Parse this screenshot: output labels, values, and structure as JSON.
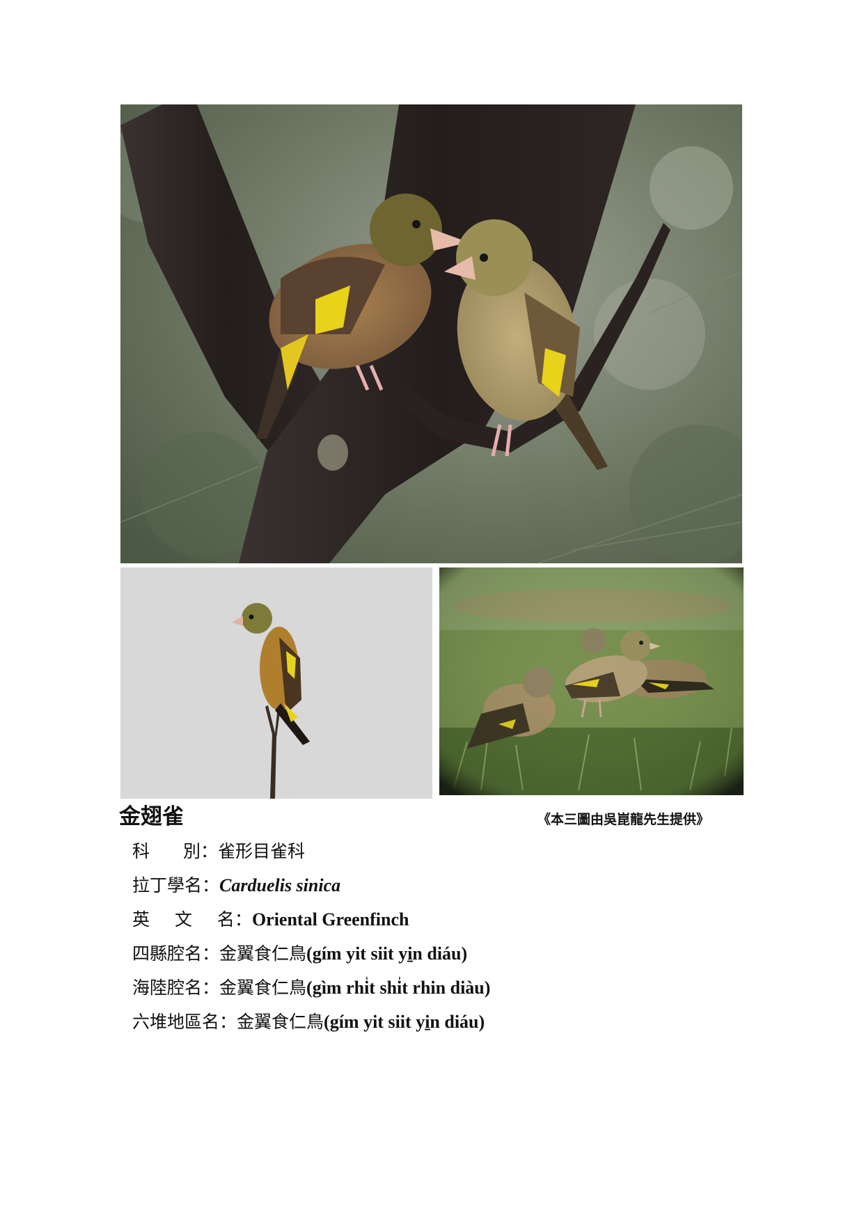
{
  "species": {
    "name": "金翅雀",
    "credit": "《本三圖由吳崑龍先生提供》"
  },
  "info": {
    "family": {
      "label_a": "科",
      "label_b": "別",
      "colon": "：",
      "value": "雀形目雀科"
    },
    "latin": {
      "label": "拉丁學名",
      "colon": "：",
      "value": "Carduelis sinica"
    },
    "english": {
      "label_a": "英 文 ",
      "label_b": "名",
      "colon": "：",
      "value": "Oriental Greenfinch"
    },
    "sixian": {
      "label": "四縣腔名",
      "colon": "：",
      "value_cjk": "金翼食仁鳥",
      "value_roman": "(gím yit siit yi̱n diáu)"
    },
    "hailu": {
      "label": "海陸腔名",
      "colon": "：",
      "value_cjk": "金翼食仁鳥",
      "value_roman": "(gìm rhi̍t shi̍t rhin diàu)"
    },
    "liudui": {
      "label": "六堆地區名",
      "colon": "：",
      "value_cjk": "金翼食仁鳥",
      "value_roman": "(gím yit siit yi̱n diáu)"
    }
  },
  "colors": {
    "bird_yellow": "#e8d21a",
    "bird_olive": "#8a7a3c",
    "bird_brown": "#7a5a3c",
    "bark": "#2e2624",
    "foliage": "#6c7a5e",
    "grass": "#6f8a45",
    "sky": "#d9d9d9"
  },
  "icons": {
    "photo_top": "two-greenfinches-on-branch-photo",
    "photo_bottom_left": "greenfinch-perched-on-twig-photo",
    "photo_bottom_right": "greenfinches-on-grass-photo"
  }
}
